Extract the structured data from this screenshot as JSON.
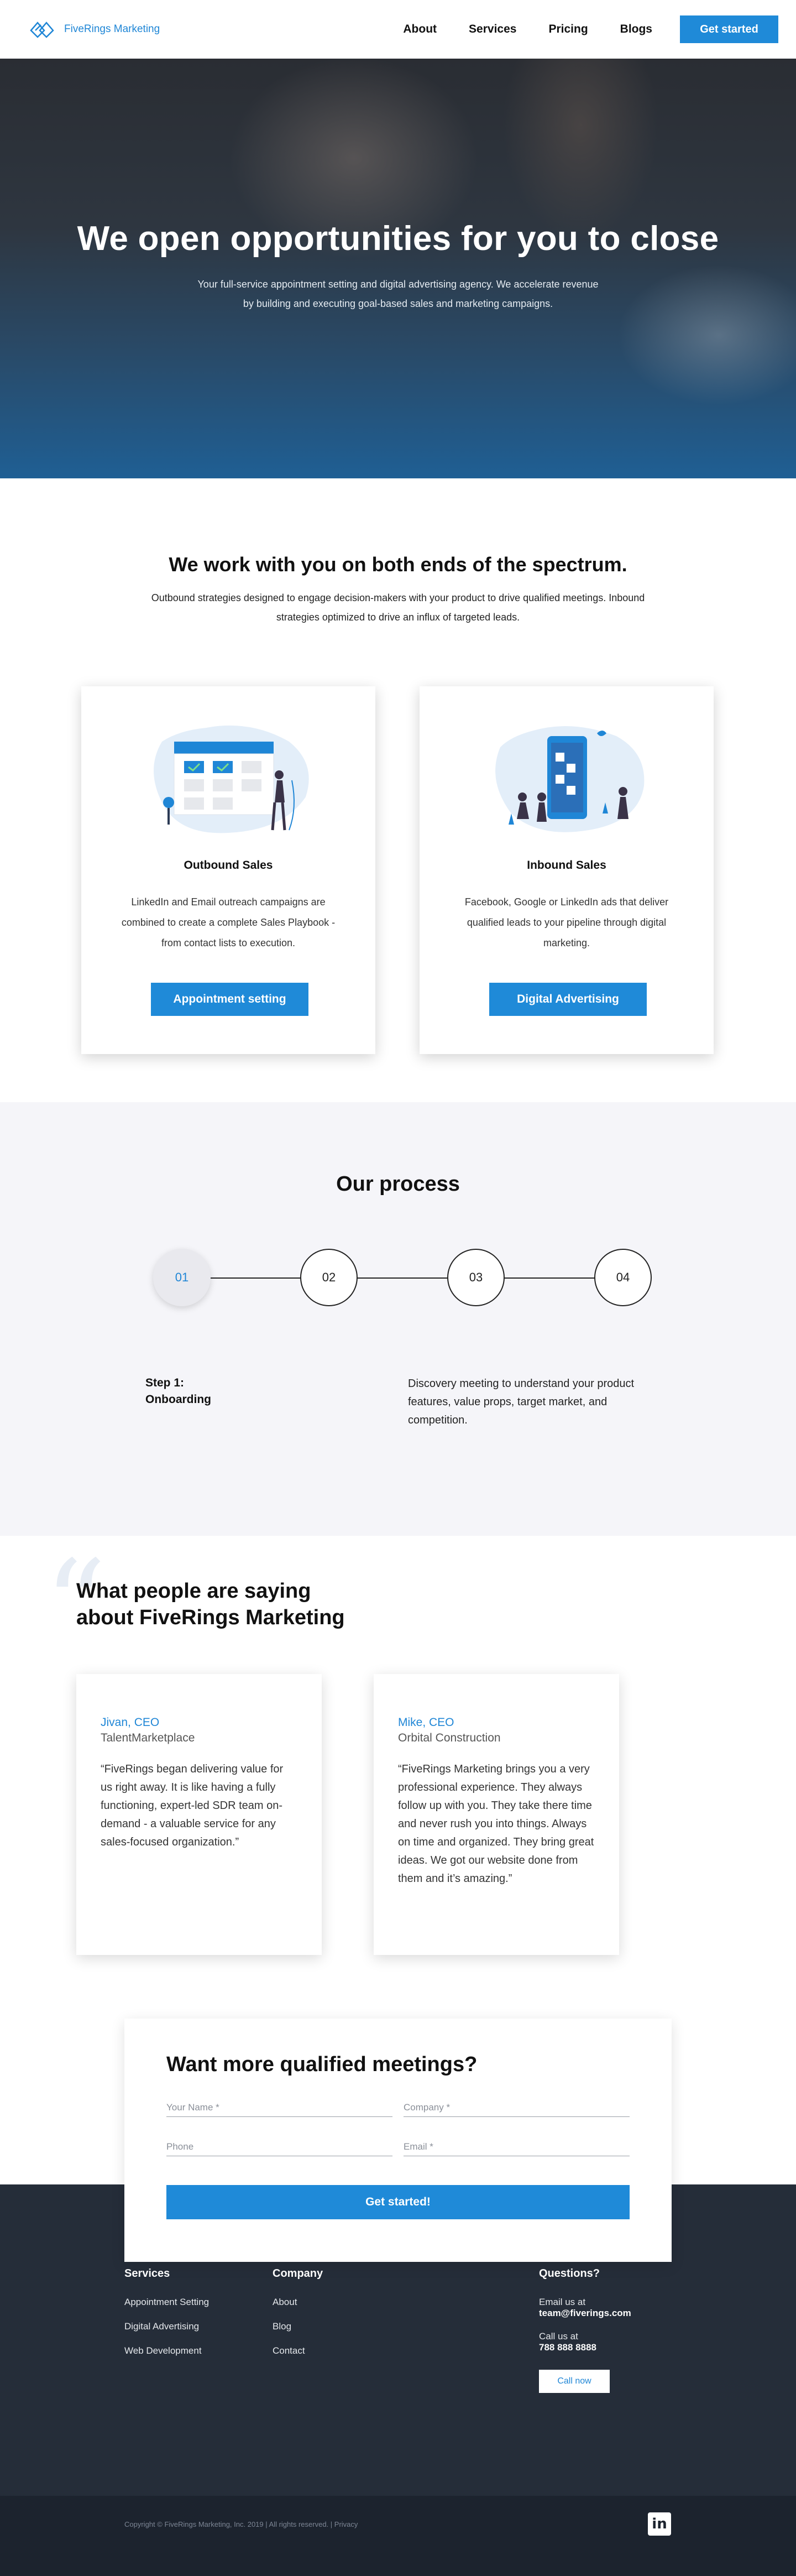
{
  "header": {
    "logo_text": "FiveRings Marketing",
    "nav": [
      "About",
      "Services",
      "Pricing",
      "Blogs"
    ],
    "cta": "Get started"
  },
  "hero": {
    "title": "We open opportunities for you to close",
    "subtitle_line1": "Your full-service appointment setting and digital advertising agency. We accelerate revenue",
    "subtitle_line2": "by building and executing goal-based sales and marketing campaigns."
  },
  "spectrum": {
    "title": "We work with you on both ends of the spectrum.",
    "desc_line1": "Outbound strategies designed to engage decision-makers with your product to drive qualified meetings. Inbound",
    "desc_line2": "strategies optimized to drive an influx of targeted leads.",
    "cards": [
      {
        "title": "Outbound Sales",
        "desc": "LinkedIn and Email outreach campaigns are combined to create a complete Sales Playbook - from contact lists to execution.",
        "button": "Appointment setting",
        "illustration": "calendar-illustration"
      },
      {
        "title": "Inbound Sales",
        "desc": "Facebook, Google or LinkedIn ads that deliver qualified leads to your pipeline through digital marketing.",
        "button": "Digital Advertising",
        "illustration": "phone-illustration"
      }
    ]
  },
  "process": {
    "title": "Our process",
    "steps": [
      "01",
      "02",
      "03",
      "04"
    ],
    "active_step": "01",
    "step_label": "Step 1:",
    "step_name": "Onboarding",
    "step_desc": "Discovery meeting to understand your product features, value props, target market, and competition."
  },
  "testimonials": {
    "quote_mark": "“",
    "title": "What people are saying about FiveRings Marketing",
    "items": [
      {
        "name": "Jivan, CEO",
        "company": "TalentMarketplace",
        "quote": "“FiveRings began delivering value for us right away. It is like having a fully functioning, expert-led SDR team on-demand - a valuable service for any sales-focused organization.”"
      },
      {
        "name": "Mike, CEO",
        "company": "Orbital Construction",
        "quote": "“FiveRings Marketing brings you a very professional experience. They always follow up with you. They take there time and never rush you into things. Always on time and organized. They bring great ideas. We got our website done from them and it’s amazing.”"
      }
    ]
  },
  "contact": {
    "title": "Want more qualified meetings?",
    "name_placeholder": "Your Name *",
    "company_placeholder": "Company *",
    "phone_placeholder": "Phone",
    "email_placeholder": "Email *",
    "submit": "Get started!"
  },
  "footer": {
    "services_title": "Services",
    "services": [
      "Appointment Setting",
      "Digital Advertising",
      "Web Development"
    ],
    "company_title": "Company",
    "company": [
      "About",
      "Blog",
      "Contact"
    ],
    "questions_title": "Questions?",
    "email_label": "Email us at",
    "email": "team@fiverings.com",
    "call_label": "Call us at",
    "phone": "788 888 8888",
    "call_button": "Call now",
    "copyright": "Copyright © FiveRings Marketing, Inc. 2019  |  All rights reserved.  |  Privacy",
    "social_icon": "in"
  },
  "colors": {
    "accent": "#1f8ad8",
    "footer_bg": "#252d39",
    "process_bg": "#f5f5f9"
  }
}
